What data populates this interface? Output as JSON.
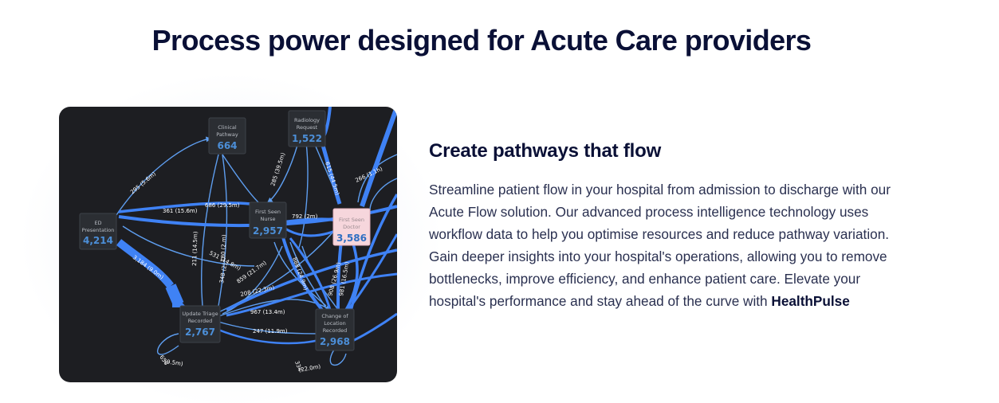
{
  "page": {
    "title": "Process power designed for Acute Care providers"
  },
  "feature": {
    "heading": "Create pathways that flow",
    "description": "Streamline patient flow in your hospital from admission to discharge with our Acute Flow solution. Our advanced process intelligence technology uses workflow data to help you optimise resources and reduce pathway variation. Gain deeper insights into your hospital's operations, allowing you to remove bottlenecks, improve efficiency, and enhance patient care. Elevate your hospital's performance and stay ahead of the curve with ",
    "brand": "HealthPulse"
  },
  "process_map": {
    "nodes": [
      {
        "id": "ed",
        "label_lines": [
          "ED",
          "Presentation"
        ],
        "count": "4,214"
      },
      {
        "id": "clinical",
        "label_lines": [
          "Clinical",
          "Pathway"
        ],
        "count": "664"
      },
      {
        "id": "radiology",
        "label_lines": [
          "Radiology",
          "Request"
        ],
        "count": "1,522"
      },
      {
        "id": "nurse",
        "label_lines": [
          "First Seen",
          "Nurse"
        ],
        "count": "2,957"
      },
      {
        "id": "doctor",
        "label_lines": [
          "First Seen",
          "Doctor"
        ],
        "count": "3,586"
      },
      {
        "id": "triage",
        "label_lines": [
          "Update Triage",
          "Recorded"
        ],
        "count": "2,767"
      },
      {
        "id": "location",
        "label_lines": [
          "Change of",
          "Location",
          "Recorded"
        ],
        "count": "2,968"
      }
    ],
    "edge_labels": [
      "295 (5.6m)",
      "361 (15.6m)",
      "686 (29.5m)",
      "211 (14.5m)",
      "180 (2.m)",
      "3,184 (9.0m)",
      "531 (14.8m)",
      "348 (2)",
      "859 (21.7m)",
      "208 (22.3m)",
      "967 (13.4m)",
      "247 (11.9m)",
      "658",
      "(9.5m)",
      "285 (39.5m)",
      "615 (44.5m)",
      "266 (1.1h)",
      "792 (2m)",
      "888 (24.9m)",
      "908 (26.9m)",
      "981 (16.5m)",
      "334",
      "(22.0m)"
    ]
  }
}
